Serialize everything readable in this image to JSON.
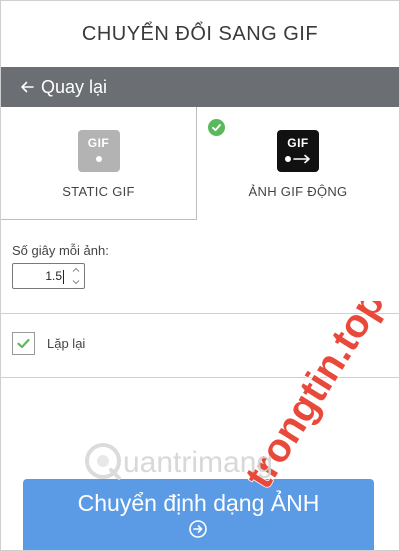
{
  "header": {
    "title": "CHUYỂN ĐỔI SANG GIF"
  },
  "nav": {
    "back_label": "Quay lại"
  },
  "options": {
    "static": {
      "tile_text": "GIF",
      "label": "STATIC GIF",
      "tile_color": "#b3b3b3"
    },
    "animated": {
      "tile_text": "GIF",
      "label": "ẢNH GIF ĐỘNG",
      "tile_color": "#111111",
      "selected": true
    }
  },
  "settings": {
    "seconds_label": "Số giây mỗi ảnh:",
    "seconds_value": "1.5",
    "repeat_label": "Lặp lại",
    "repeat_checked": true
  },
  "action": {
    "convert_label": "Chuyển định dạng ẢNH"
  },
  "watermark": {
    "site": "trongtin.top",
    "brand": "uantrimang"
  },
  "colors": {
    "back_bar": "#6b6e73",
    "accent_button": "#5b9be6",
    "check_green": "#5cb85c",
    "watermark_red": "#e8493a",
    "watermark_blue": "#2e6fd4"
  }
}
